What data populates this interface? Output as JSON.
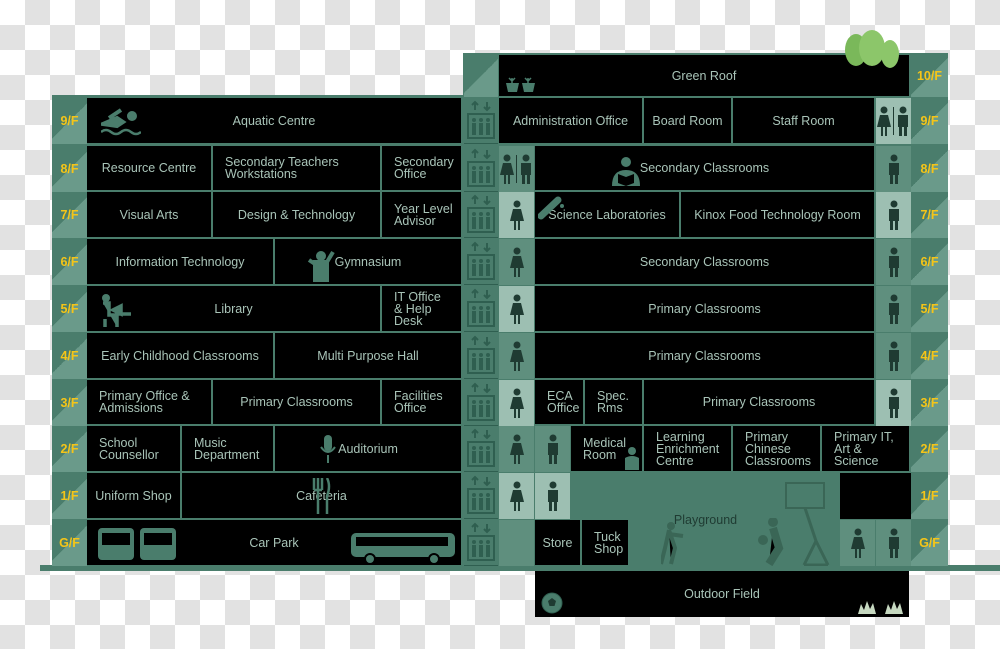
{
  "colors": {
    "floor_label": "#f5c518",
    "building": "#4a7d6c",
    "room": "#000000",
    "room_text": "#a9c4b8",
    "toilet_light": "#9dbfb2",
    "toilet_mid": "#5f8f7e",
    "tree": "#8cc66a"
  },
  "floor_labels_left": [
    "9/F",
    "8/F",
    "7/F",
    "6/F",
    "5/F",
    "4/F",
    "3/F",
    "2/F",
    "1/F",
    "G/F"
  ],
  "floor_labels_right": [
    "10/F",
    "9/F",
    "8/F",
    "7/F",
    "6/F",
    "5/F",
    "4/F",
    "3/F",
    "2/F",
    "1/F",
    "G/F"
  ],
  "rooms": {
    "aquatic": "Aquatic Centre",
    "resource": "Resource Centre",
    "sec_teachers": "Secondary Teachers\nWorkstations",
    "sec_office": "Secondary\nOffice",
    "visual_arts": "Visual Arts",
    "dt": "Design & Technology",
    "year_level": "Year Level\nAdvisor",
    "info_tech": "Information Technology",
    "gym": "Gymnasium",
    "library": "Library",
    "it_office": "IT Office\n& Help Desk",
    "early_childhood": "Early Childhood Classrooms",
    "mph": "Multi Purpose Hall",
    "primary_office": "Primary Office &\nAdmissions",
    "primary_cls_l3": "Primary Classrooms",
    "facilities": "Facilities\nOffice",
    "counsellor": "School\nCounsellor",
    "music": "Music\nDepartment",
    "auditorium": "Auditorium",
    "uniform": "Uniform Shop",
    "cafeteria": "Cafeteria",
    "car_park": "Car Park",
    "green_roof": "Green Roof",
    "admin": "Administration Office",
    "board": "Board Room",
    "staff": "Staff Room",
    "sec_cls_8": "Secondary Classrooms",
    "science": "Science Laboratories",
    "kinox": "Kinox Food Technology Room",
    "sec_cls_6": "Secondary Classrooms",
    "pri_cls_5": "Primary Classrooms",
    "pri_cls_4": "Primary Classrooms",
    "eca": "ECA\nOffice",
    "spec": "Spec.\nRms",
    "pri_cls_3": "Primary Classrooms",
    "medical": "Medical\nRoom",
    "lec": "Learning\nEnrichment\nCentre",
    "pri_chinese": "Primary\nChinese\nClassrooms",
    "pri_it": "Primary IT,\nArt & Science",
    "store": "Store",
    "tuck": "Tuck\nShop",
    "playground": "Playground",
    "outdoor": "Outdoor Field"
  }
}
